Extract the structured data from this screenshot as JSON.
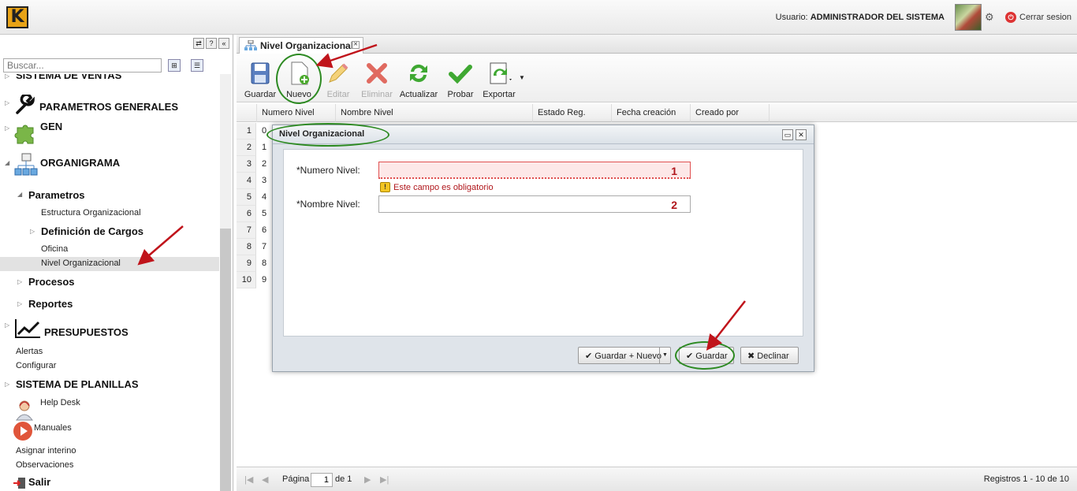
{
  "header": {
    "logo_letter": "K",
    "user_label": "Usuario:",
    "user_name": "ADMINISTRADOR DEL SISTEMA",
    "logout_label": "Cerrar sesion"
  },
  "sidebar": {
    "search_placeholder": "Buscar...",
    "items": [
      {
        "label": "SISTEMA DE VENTAS"
      },
      {
        "label": "PARAMETROS GENERALES"
      },
      {
        "label": "GEN"
      },
      {
        "label": "ORGANIGRAMA"
      },
      {
        "label": "Parametros"
      },
      {
        "label": "Estructura Organizacional"
      },
      {
        "label": "Definición de Cargos"
      },
      {
        "label": "Oficina"
      },
      {
        "label": "Nivel Organizacional"
      },
      {
        "label": "Procesos"
      },
      {
        "label": "Reportes"
      },
      {
        "label": "PRESUPUESTOS"
      },
      {
        "label": "Alertas"
      },
      {
        "label": "Configurar"
      },
      {
        "label": "SISTEMA DE PLANILLAS"
      },
      {
        "label": "Help Desk"
      },
      {
        "label": "Manuales"
      },
      {
        "label": "Asignar interino"
      },
      {
        "label": "Observaciones"
      },
      {
        "label": "Salir"
      }
    ]
  },
  "tab": {
    "label": "Nivel Organizacional"
  },
  "toolbar": {
    "guardar": "Guardar",
    "nuevo": "Nuevo",
    "editar": "Editar",
    "eliminar": "Eliminar",
    "actualizar": "Actualizar",
    "probar": "Probar",
    "exportar": "Exportar"
  },
  "grid": {
    "columns": [
      "Numero Nivel",
      "Nombre Nivel",
      "Estado Reg.",
      "Fecha creación",
      "Creado por"
    ],
    "rows": [
      {
        "n": "1",
        "v": "0"
      },
      {
        "n": "2",
        "v": "1"
      },
      {
        "n": "3",
        "v": "2"
      },
      {
        "n": "4",
        "v": "3"
      },
      {
        "n": "5",
        "v": "4"
      },
      {
        "n": "6",
        "v": "5"
      },
      {
        "n": "7",
        "v": "6"
      },
      {
        "n": "8",
        "v": "7"
      },
      {
        "n": "9",
        "v": "8"
      },
      {
        "n": "10",
        "v": "9"
      }
    ]
  },
  "pager": {
    "page_label": "Página",
    "page_value": "1",
    "of_label": "de 1",
    "records": "Registros 1 - 10 de 10"
  },
  "dialog": {
    "title": "Nivel Organizacional",
    "field1_label": "*Numero Nivel:",
    "field1_value": "1",
    "field1_error": "Este campo es obligatorio",
    "field2_label": "*Nombre Nivel:",
    "field2_value": "2",
    "btn_save_new": "Guardar + Nuevo",
    "btn_save": "Guardar",
    "btn_decline": "Declinar"
  },
  "colors": {
    "accent_green": "#2d8a22",
    "arrow_red": "#c0141b",
    "error_red": "#b0161b"
  }
}
